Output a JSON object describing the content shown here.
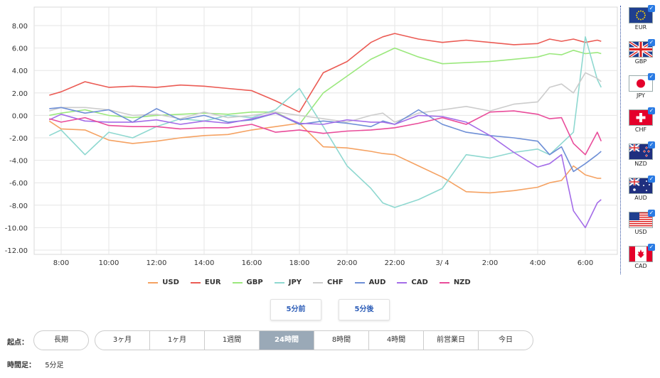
{
  "chart_data": {
    "type": "line",
    "ylim": [
      -12,
      8
    ],
    "y_ticks": [
      "8.00",
      "6.00",
      "4.00",
      "2.00",
      "0.00",
      "-2.00",
      "-4.00",
      "-6.00",
      "-8.00",
      "-10.00",
      "-12.00"
    ],
    "x_ticks": [
      "8:00",
      "10:00",
      "12:00",
      "14:00",
      "16:00",
      "18:00",
      "20:00",
      "22:00",
      "3/ 4",
      "2:00",
      "4:00",
      "6:00"
    ],
    "x": [
      "7:30",
      "8:00",
      "9:00",
      "10:00",
      "11:00",
      "12:00",
      "13:00",
      "14:00",
      "15:00",
      "16:00",
      "17:00",
      "18:00",
      "19:00",
      "20:00",
      "21:00",
      "21:30",
      "22:00",
      "23:00",
      "3/ 4",
      "1:00",
      "2:00",
      "3:00",
      "4:00",
      "4:30",
      "5:00",
      "5:30",
      "6:00",
      "6:30",
      "6:40"
    ],
    "grid": true,
    "series": [
      {
        "name": "USD",
        "color": "#f5a262",
        "values": [
          -0.5,
          -1.2,
          -1.3,
          -2.2,
          -2.5,
          -2.3,
          -2.0,
          -1.8,
          -1.7,
          -1.3,
          -1.0,
          -0.7,
          -2.8,
          -2.9,
          -3.2,
          -3.4,
          -3.5,
          -4.5,
          -5.5,
          -6.8,
          -6.9,
          -6.7,
          -6.4,
          -6.0,
          -5.8,
          -4.5,
          -5.3,
          -5.6,
          -5.6
        ]
      },
      {
        "name": "EUR",
        "color": "#eb5b54",
        "values": [
          1.8,
          2.1,
          3.0,
          2.5,
          2.6,
          2.5,
          2.7,
          2.6,
          2.4,
          2.2,
          1.3,
          0.3,
          3.8,
          4.8,
          6.5,
          7.0,
          7.3,
          6.8,
          6.5,
          6.7,
          6.5,
          6.3,
          6.4,
          6.8,
          6.6,
          6.8,
          6.5,
          6.7,
          6.6
        ]
      },
      {
        "name": "GBP",
        "color": "#9be87d",
        "values": [
          0.0,
          0.2,
          0.5,
          0.0,
          -0.2,
          0.0,
          0.1,
          0.2,
          0.1,
          0.3,
          0.3,
          -0.8,
          2.0,
          3.5,
          5.0,
          5.5,
          6.0,
          5.2,
          4.6,
          4.7,
          4.8,
          5.0,
          5.2,
          5.5,
          5.4,
          5.8,
          5.5,
          5.6,
          5.5
        ]
      },
      {
        "name": "JPY",
        "color": "#8ed8d0",
        "values": [
          -1.8,
          -1.3,
          -3.5,
          -1.5,
          -2.0,
          -1.0,
          -0.3,
          -0.5,
          0.0,
          -0.2,
          0.5,
          2.4,
          -1.0,
          -4.5,
          -6.5,
          -7.8,
          -8.2,
          -7.5,
          -6.5,
          -3.5,
          -3.8,
          -3.3,
          -3.0,
          -3.5,
          -2.5,
          -1.5,
          7.0,
          3.2,
          2.5
        ]
      },
      {
        "name": "CHF",
        "color": "#cccccc",
        "values": [
          0.4,
          0.7,
          0.7,
          0.5,
          0.0,
          0.1,
          -0.3,
          0.3,
          -0.2,
          0.0,
          0.3,
          0.0,
          -0.3,
          -0.6,
          0.0,
          0.2,
          -0.6,
          0.2,
          0.5,
          0.8,
          0.4,
          1.0,
          1.2,
          2.5,
          2.8,
          2.0,
          3.8,
          3.3,
          3.0
        ]
      },
      {
        "name": "AUD",
        "color": "#6e8fd6",
        "values": [
          0.6,
          0.7,
          0.2,
          0.5,
          -0.6,
          0.6,
          -0.4,
          0.0,
          -0.6,
          -0.4,
          0.2,
          -0.8,
          -0.5,
          -0.7,
          -1.0,
          -0.5,
          -0.8,
          0.5,
          -0.8,
          -1.5,
          -1.8,
          -2.0,
          -2.3,
          -3.5,
          -2.8,
          -5.0,
          -4.3,
          -3.5,
          -3.2
        ]
      },
      {
        "name": "CAD",
        "color": "#a46de8",
        "values": [
          -0.4,
          0.1,
          -0.5,
          -0.6,
          -0.6,
          -0.4,
          -0.8,
          -0.5,
          -0.7,
          -0.3,
          0.2,
          -0.7,
          -0.8,
          -0.4,
          -0.6,
          -0.6,
          -0.8,
          0.0,
          -0.1,
          -0.6,
          -1.8,
          -3.3,
          -4.6,
          -4.3,
          -3.5,
          -8.5,
          -10.0,
          -7.8,
          -7.5
        ]
      },
      {
        "name": "NZD",
        "color": "#e94c9a",
        "values": [
          -0.3,
          -0.6,
          -0.2,
          -0.9,
          -1.0,
          -1.0,
          -1.2,
          -1.1,
          -1.1,
          -0.8,
          -1.5,
          -1.3,
          -1.6,
          -1.4,
          -1.3,
          -1.2,
          -1.1,
          -0.7,
          -0.2,
          -0.8,
          0.3,
          0.4,
          0.1,
          -0.3,
          -0.2,
          -2.5,
          -3.5,
          -1.5,
          -2.3
        ]
      }
    ]
  },
  "flags": [
    {
      "code": "EUR"
    },
    {
      "code": "GBP"
    },
    {
      "code": "JPY"
    },
    {
      "code": "CHF"
    },
    {
      "code": "NZD"
    },
    {
      "code": "AUD"
    },
    {
      "code": "USD"
    },
    {
      "code": "CAD"
    }
  ],
  "check_glyph": "✓",
  "buttons": {
    "prev": "5分前",
    "next": "5分後"
  },
  "origin": {
    "label": "起点：",
    "long": "長期",
    "periods": [
      "3ヶ月",
      "1ヶ月",
      "1週間",
      "24時間",
      "8時間",
      "4時間",
      "前営業日",
      "今日"
    ],
    "active": "24時間"
  },
  "interval": {
    "label": "時間足：",
    "value": "5分足"
  }
}
